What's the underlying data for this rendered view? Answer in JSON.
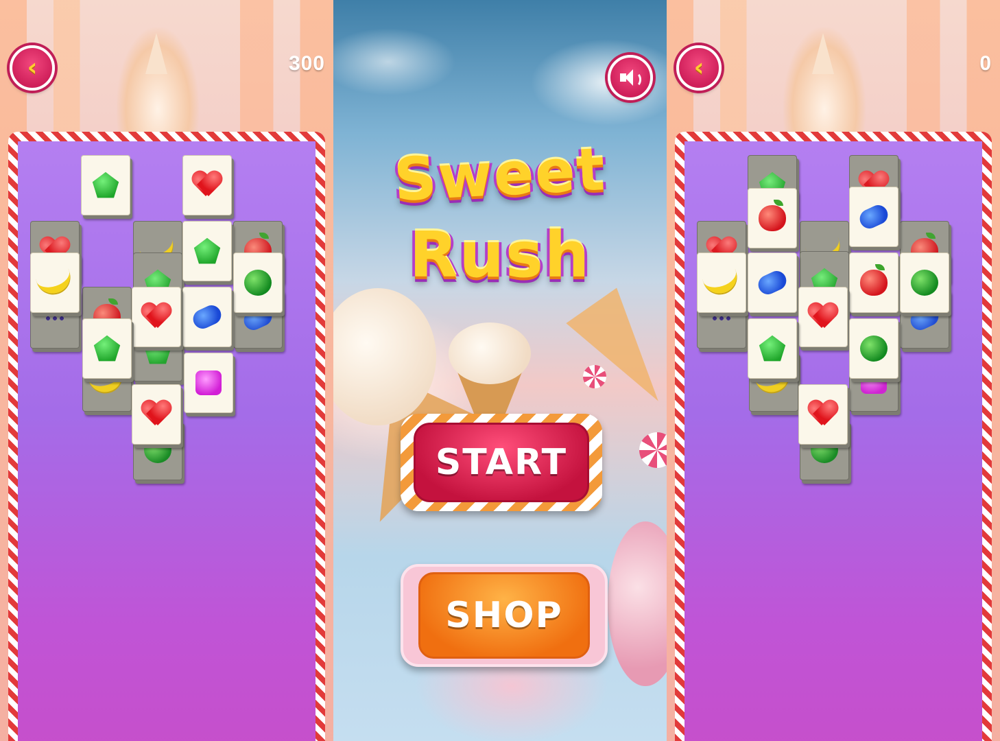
{
  "screens": {
    "left": {
      "score": "300"
    },
    "center": {
      "title_line1": "Sweet",
      "title_line2": "Rush",
      "start_label": "START",
      "shop_label": "SHOP"
    },
    "right": {
      "score": "0"
    }
  },
  "icons": {
    "back": "back-arrow-icon",
    "sound": "speaker-icon"
  },
  "tile_symbols": [
    "green-pentagon",
    "red-heart",
    "blue-gem",
    "magenta-square",
    "green-melon",
    "red-apple",
    "banana",
    "grapes"
  ],
  "colors": {
    "board_purple": "#a46ce8",
    "candy_stripe": "#e23a3a",
    "start_red": "#c4123e",
    "shop_orange": "#f06f10",
    "title_yellow": "#ffd22a"
  }
}
